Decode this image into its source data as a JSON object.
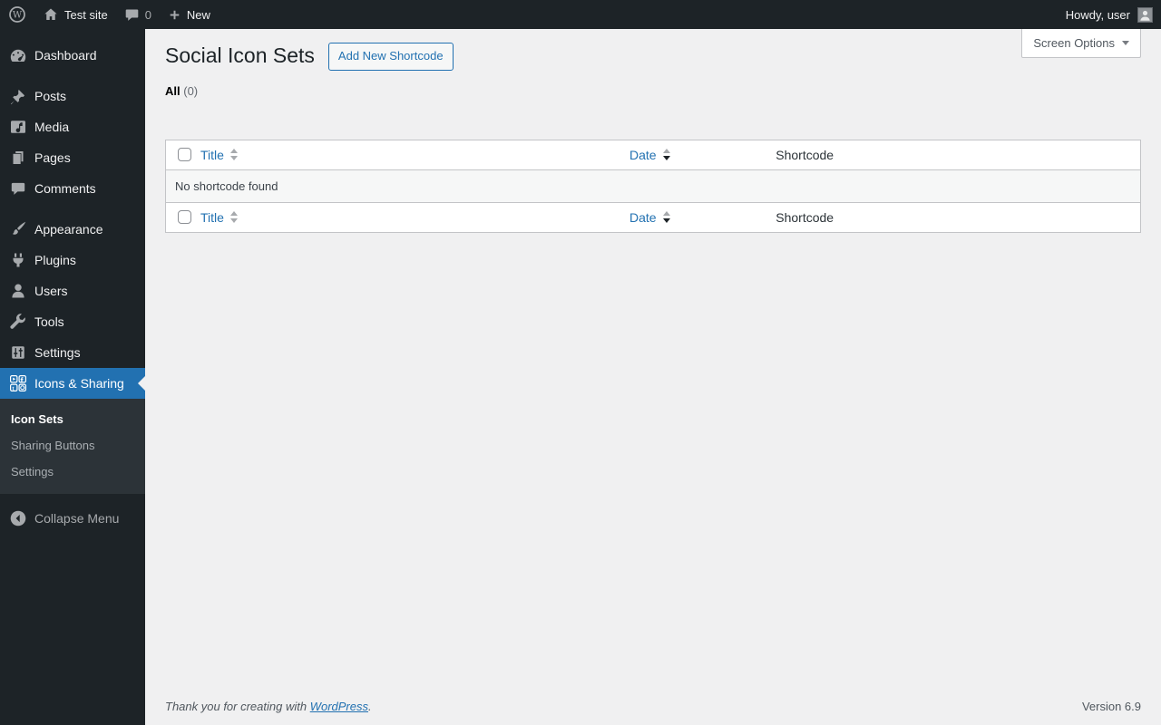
{
  "colors": {
    "accent": "#2271b1",
    "admin_bar_bg": "#1d2327",
    "menu_bg": "#1d2327",
    "submenu_bg": "#2c3338",
    "content_bg": "#f0f0f1",
    "table_border": "#c3c4c7"
  },
  "admin_bar": {
    "site_name": "Test site",
    "comment_count": "0",
    "new_label": "New",
    "howdy_text": "Howdy, user"
  },
  "sidebar": {
    "items": [
      {
        "label": "Dashboard"
      },
      {
        "label": "Posts"
      },
      {
        "label": "Media"
      },
      {
        "label": "Pages"
      },
      {
        "label": "Comments"
      },
      {
        "label": "Appearance"
      },
      {
        "label": "Plugins"
      },
      {
        "label": "Users"
      },
      {
        "label": "Tools"
      },
      {
        "label": "Settings"
      },
      {
        "label": "Icons & Sharing"
      }
    ],
    "submenu": [
      {
        "label": "Icon Sets"
      },
      {
        "label": "Sharing Buttons"
      },
      {
        "label": "Settings"
      }
    ],
    "collapse_label": "Collapse Menu"
  },
  "screen_options": {
    "label": "Screen Options"
  },
  "page": {
    "title": "Social Icon Sets",
    "add_button_label": "Add New Shortcode",
    "filter_all_label": "All",
    "filter_all_count": "(0)"
  },
  "table": {
    "columns": {
      "title": "Title",
      "date": "Date",
      "shortcode": "Shortcode"
    },
    "empty_message": "No shortcode found"
  },
  "footer": {
    "thanks_prefix": "Thank you for creating with ",
    "wordpress_link": "WordPress",
    "thanks_suffix": ".",
    "version": "Version 6.9"
  },
  "icons": {
    "wordpress-logo-icon": "W in circle",
    "home-icon": "house",
    "comments-bubble-icon": "speech bubble",
    "plus-icon": "plus",
    "avatar": "person silhouette",
    "dashboard-icon": "gauge",
    "posts-icon": "pushpin",
    "media-icon": "note in frame",
    "pages-icon": "stacked pages",
    "comments-icon": "speech bubble",
    "appearance-icon": "paintbrush",
    "plugins-icon": "plug",
    "users-icon": "person",
    "tools-icon": "wrench",
    "settings-icon": "sliders panel",
    "icons-sharing-icon": "2x2 social grid",
    "collapse-arrow-icon": "circled left arrow",
    "chevron-down-icon": "down triangle",
    "sort-icons": "up/down triangles"
  }
}
